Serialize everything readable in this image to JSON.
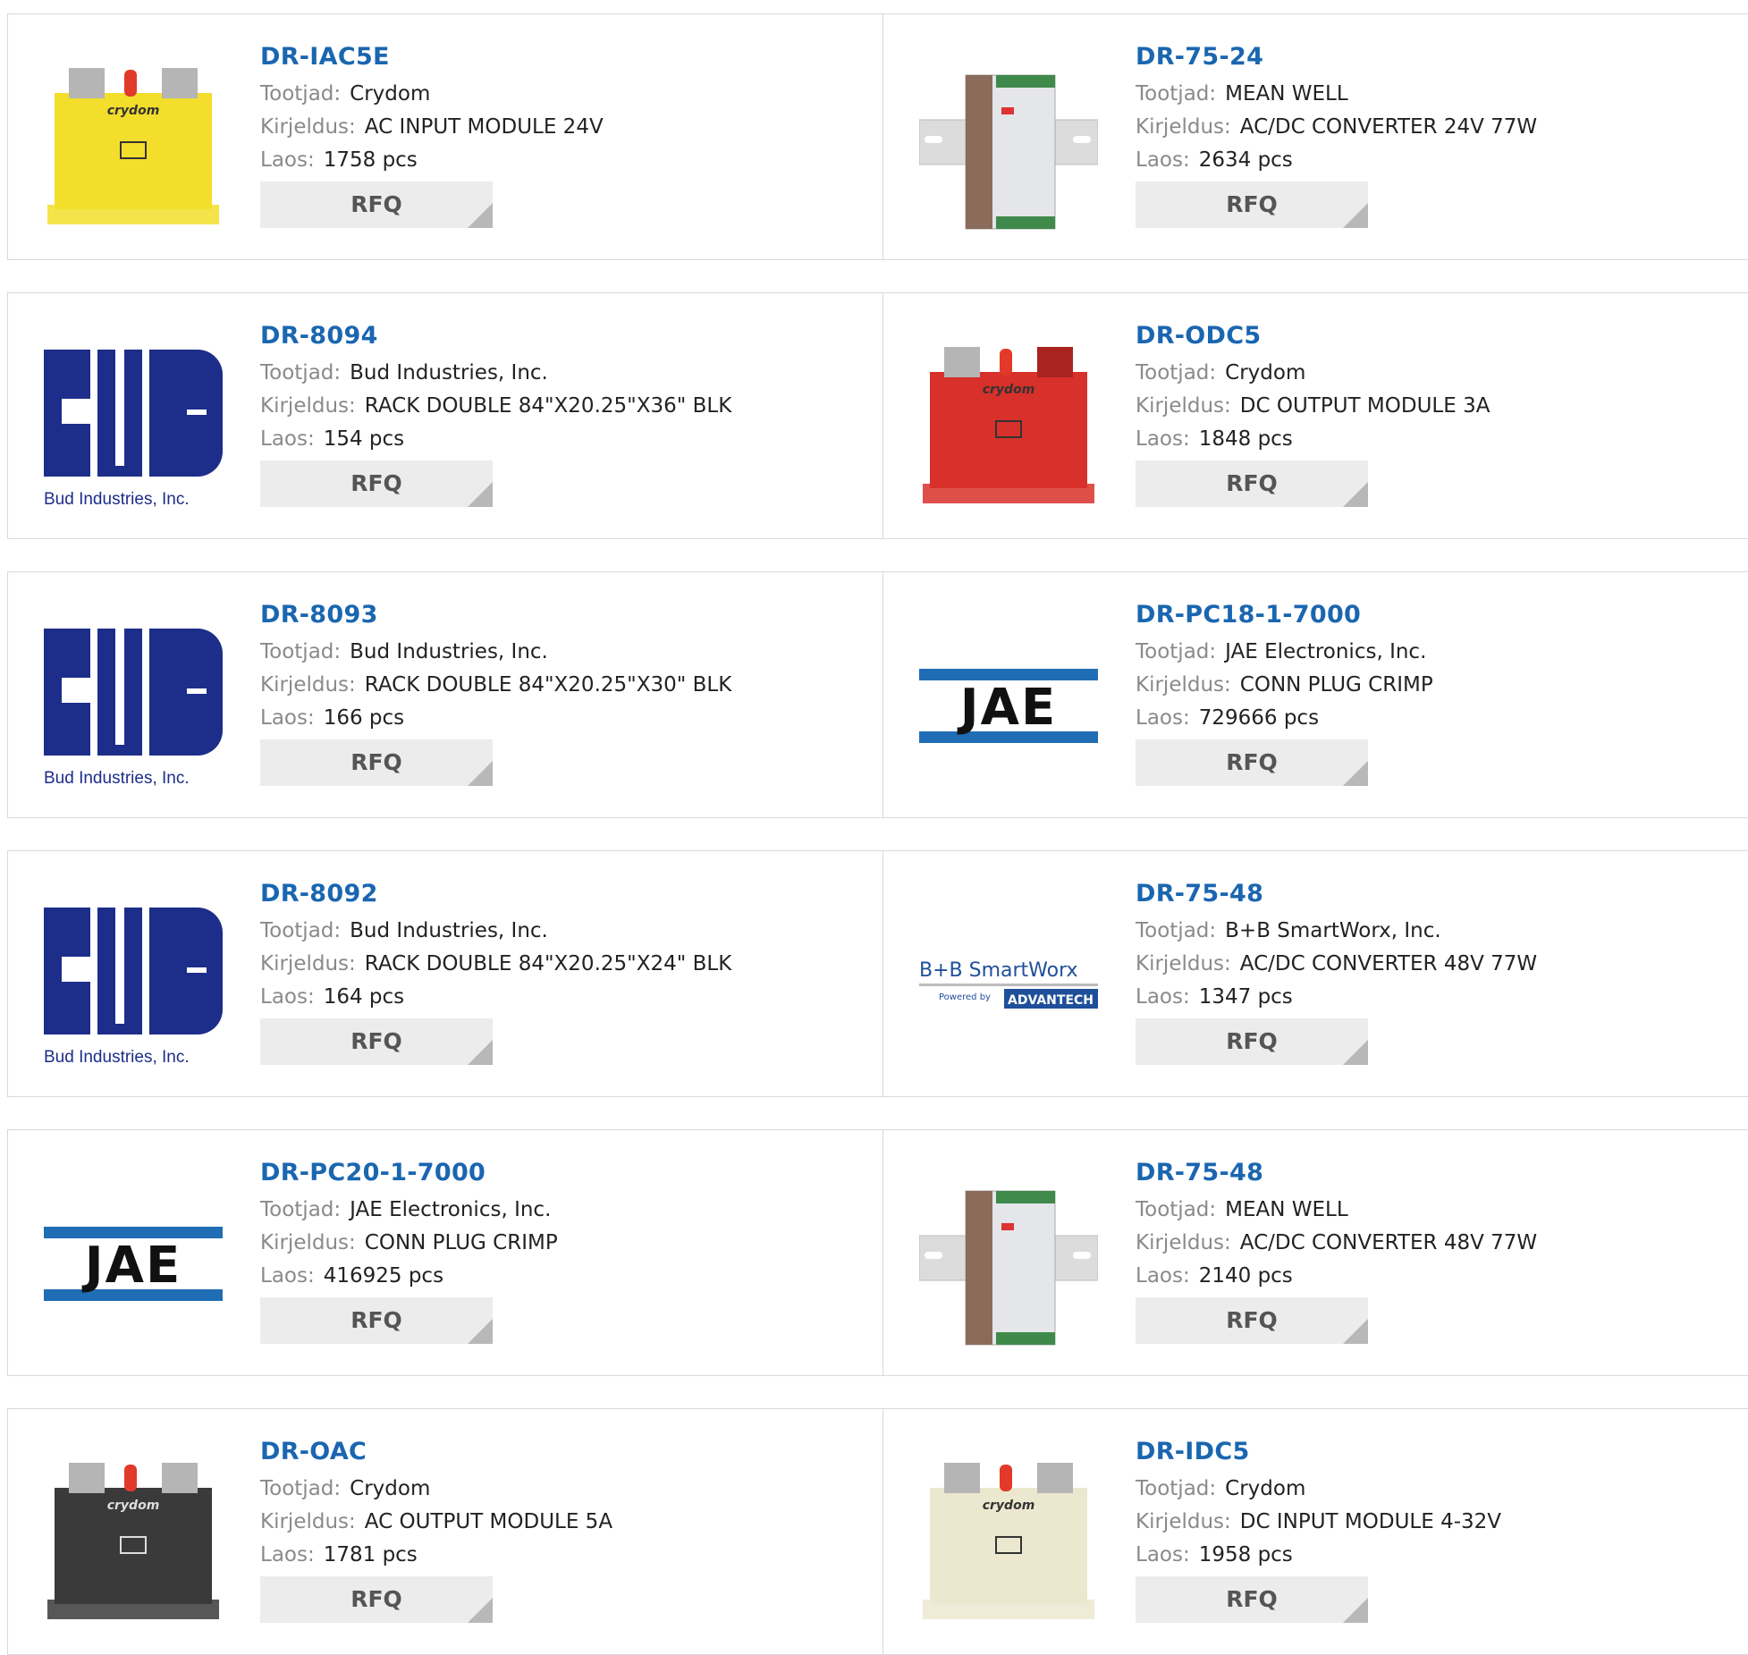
{
  "labels": {
    "manufacturer": "Tootjad:",
    "description": "Kirjeldus:",
    "stock": "Laos:",
    "rfq": "RFQ"
  },
  "rows": [
    [
      {
        "pn": "DR-IAC5E",
        "manufacturer": "Crydom",
        "description": "AC INPUT MODULE 24V",
        "stock": "1758 pcs",
        "image": "crydom-yellow"
      },
      {
        "pn": "DR-75-24",
        "manufacturer": "MEAN WELL",
        "description": "AC/DC CONVERTER 24V 77W",
        "stock": "2634 pcs",
        "image": "meanwell-psu"
      }
    ],
    [
      {
        "pn": "DR-8094",
        "manufacturer": "Bud Industries, Inc.",
        "description": "RACK DOUBLE 84\"X20.25\"X36\" BLK",
        "stock": "154 pcs",
        "image": "bud-logo"
      },
      {
        "pn": "DR-ODC5",
        "manufacturer": "Crydom",
        "description": "DC OUTPUT MODULE 3A",
        "stock": "1848 pcs",
        "image": "crydom-red"
      }
    ],
    [
      {
        "pn": "DR-8093",
        "manufacturer": "Bud Industries, Inc.",
        "description": "RACK DOUBLE 84\"X20.25\"X30\" BLK",
        "stock": "166 pcs",
        "image": "bud-logo"
      },
      {
        "pn": "DR-PC18-1-7000",
        "manufacturer": "JAE Electronics, Inc.",
        "description": "CONN PLUG CRIMP",
        "stock": "729666 pcs",
        "image": "jae-logo"
      }
    ],
    [
      {
        "pn": "DR-8092",
        "manufacturer": "Bud Industries, Inc.",
        "description": "RACK DOUBLE 84\"X20.25\"X24\" BLK",
        "stock": "164 pcs",
        "image": "bud-logo"
      },
      {
        "pn": "DR-75-48",
        "manufacturer": "B+B SmartWorx, Inc.",
        "description": "AC/DC CONVERTER 48V 77W",
        "stock": "1347 pcs",
        "image": "bb-smartworx-logo"
      }
    ],
    [
      {
        "pn": "DR-PC20-1-7000",
        "manufacturer": "JAE Electronics, Inc.",
        "description": "CONN PLUG CRIMP",
        "stock": "416925 pcs",
        "image": "jae-logo"
      },
      {
        "pn": "DR-75-48",
        "manufacturer": "MEAN WELL",
        "description": "AC/DC CONVERTER 48V 77W",
        "stock": "2140 pcs",
        "image": "meanwell-psu"
      }
    ],
    [
      {
        "pn": "DR-OAC",
        "manufacturer": "Crydom",
        "description": "AC OUTPUT MODULE 5A",
        "stock": "1781 pcs",
        "image": "crydom-black"
      },
      {
        "pn": "DR-IDC5",
        "manufacturer": "Crydom",
        "description": "DC INPUT MODULE 4-32V",
        "stock": "1958 pcs",
        "image": "crydom-cream"
      }
    ]
  ],
  "logos": {
    "bud": "Bud Industries, Inc.",
    "jae": "JAE",
    "bb": "B+B SmartWorx",
    "bb_powered": "Powered by",
    "bb_advantech": "ADVANTECH",
    "crydom": "crydom"
  },
  "colors": {
    "link": "#1a66b0",
    "bud": "#1d2d8a",
    "jae_bar": "#1f6db5",
    "crydom-yellow": "#f3de2b",
    "crydom-red": "#d8302a",
    "crydom-black": "#3a3a3a",
    "crydom-cream": "#ece8cf"
  }
}
